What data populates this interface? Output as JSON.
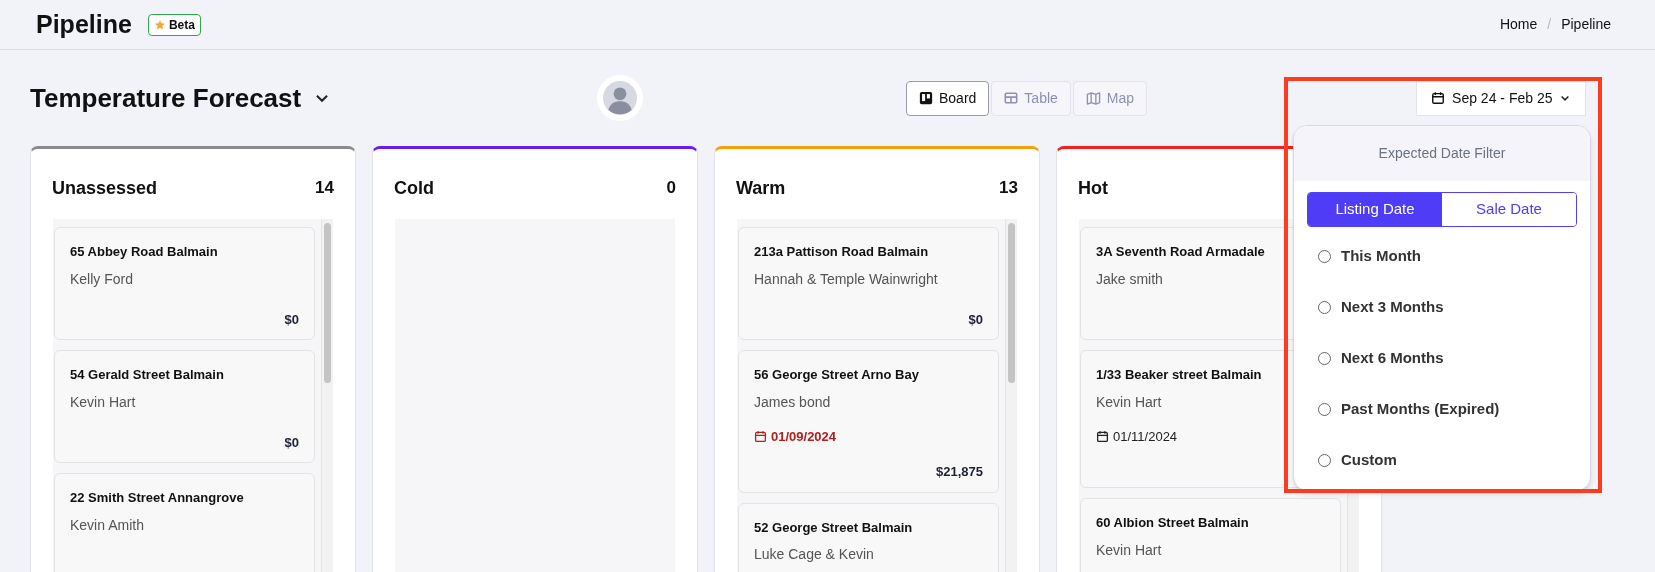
{
  "header": {
    "title": "Pipeline",
    "badge": "Beta",
    "breadcrumb": {
      "items": [
        "Home",
        "Pipeline"
      ],
      "separator": "/"
    }
  },
  "toolbar": {
    "title": "Temperature Forecast",
    "views": [
      {
        "label": "Board",
        "selected": true
      },
      {
        "label": "Table",
        "selected": false
      },
      {
        "label": "Map",
        "selected": false
      }
    ],
    "date_button": "Sep 24 - Feb 25"
  },
  "columns": [
    {
      "name": "Unassessed",
      "count": "14",
      "color": "#8c8c8c",
      "cards": [
        {
          "address": "65 Abbey Road Balmain",
          "contact": "Kelly Ford",
          "price": "$0"
        },
        {
          "address": "54 Gerald Street Balmain",
          "contact": "Kevin Hart",
          "price": "$0"
        },
        {
          "address": "22 Smith Street Annangrove",
          "contact": "Kevin Amith"
        }
      ]
    },
    {
      "name": "Cold",
      "count": "0",
      "color": "#6a1bf5"
    },
    {
      "name": "Warm",
      "count": "13",
      "color": "#f5a10a",
      "cards": [
        {
          "address": "213a Pattison Road Balmain",
          "contact": "Hannah & Temple Wainwright",
          "price": "$0"
        },
        {
          "address": "56 George Street Arno Bay",
          "contact": "James bond",
          "date": "01/09/2024",
          "overdue": true,
          "price": "$21,875"
        },
        {
          "address": "52 George Street Balmain",
          "contact": "Luke Cage & Kevin"
        }
      ]
    },
    {
      "name": "Hot",
      "color": "#f5201b",
      "cards": [
        {
          "address": "3A Seventh Road Armadale",
          "contact": "Jake smith"
        },
        {
          "address": "1/33 Beaker street Balmain",
          "contact": "Kevin Hart",
          "date": "01/11/2024",
          "overdue": false
        },
        {
          "address": "60 Albion Street Balmain",
          "contact": "Kevin Hart"
        }
      ]
    }
  ],
  "date_filter": {
    "title": "Expected Date Filter",
    "tabs": [
      {
        "label": "Listing Date",
        "selected": true
      },
      {
        "label": "Sale Date",
        "selected": false
      }
    ],
    "options": [
      {
        "label": "This Month",
        "selected": false
      },
      {
        "label": "Next 3 Months",
        "selected": false
      },
      {
        "label": "Next 6 Months",
        "selected": false
      },
      {
        "label": "Past Months (Expired)",
        "selected": false
      },
      {
        "label": "Custom",
        "selected": false
      }
    ]
  }
}
